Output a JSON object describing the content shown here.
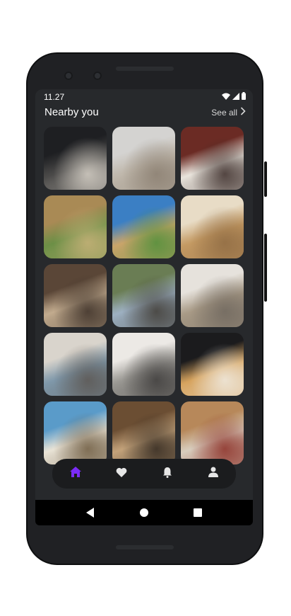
{
  "status_bar": {
    "time": "11.27",
    "icons": [
      "wifi-icon",
      "signal-icon",
      "battery-icon"
    ]
  },
  "header": {
    "title": "Nearby you",
    "see_all_label": "See all",
    "see_all_icon": "chevron-right-icon"
  },
  "gallery": {
    "tiles": [
      {
        "name": "dark-bedroom-photo",
        "colors": [
          "#1e1f22",
          "#4b4a49",
          "#d9d3c9"
        ]
      },
      {
        "name": "white-bedroom-photo",
        "colors": [
          "#d4d3d1",
          "#bfb7ab",
          "#8a7e70"
        ]
      },
      {
        "name": "red-accent-bedroom-photo",
        "colors": [
          "#6b2b24",
          "#e9e4dc",
          "#3a2b28"
        ]
      },
      {
        "name": "arched-corridor-photo",
        "colors": [
          "#a98a55",
          "#6c8f46",
          "#c9b27a"
        ]
      },
      {
        "name": "pool-umbrella-photo",
        "colors": [
          "#3b7fc4",
          "#c9a46a",
          "#4f8f3a"
        ]
      },
      {
        "name": "beige-bedroom-photo",
        "colors": [
          "#e8dcc6",
          "#c49a63",
          "#8f6b43"
        ]
      },
      {
        "name": "warm-bedroom-photo",
        "colors": [
          "#5a4637",
          "#c2ab8e",
          "#3a2e26"
        ]
      },
      {
        "name": "glass-room-photo",
        "colors": [
          "#6a7d54",
          "#9db0c1",
          "#3f3a33"
        ]
      },
      {
        "name": "bright-bedroom-photo",
        "colors": [
          "#e6e2dc",
          "#a89a86",
          "#6f675e"
        ]
      },
      {
        "name": "sea-view-bedroom-photo",
        "colors": [
          "#d9d4cc",
          "#7f98aa",
          "#5b5550"
        ]
      },
      {
        "name": "living-room-photo",
        "colors": [
          "#ece9e5",
          "#9a9893",
          "#3d3b3a"
        ]
      },
      {
        "name": "bathroom-photo",
        "colors": [
          "#1b1b1d",
          "#d6a35e",
          "#f0ece4"
        ]
      },
      {
        "name": "outdoor-daybed-photo",
        "colors": [
          "#5a9bc9",
          "#e9e3d6",
          "#6d5a3f"
        ]
      },
      {
        "name": "fireplace-lounge-photo",
        "colors": [
          "#6b4e33",
          "#c3a27a",
          "#2f261e"
        ]
      },
      {
        "name": "suite-bedroom-photo",
        "colors": [
          "#b7885a",
          "#d8cdbd",
          "#8b2d25"
        ]
      }
    ]
  },
  "bottom_nav": {
    "active_color": "#7b2cf6",
    "inactive_color": "#e6e6e6",
    "items": [
      {
        "icon": "home-icon",
        "active": true
      },
      {
        "icon": "heart-icon",
        "active": false
      },
      {
        "icon": "bell-icon",
        "active": false
      },
      {
        "icon": "person-icon",
        "active": false
      }
    ]
  },
  "system_nav": {
    "items": [
      "back-icon",
      "home-circle-icon",
      "recents-icon"
    ]
  }
}
